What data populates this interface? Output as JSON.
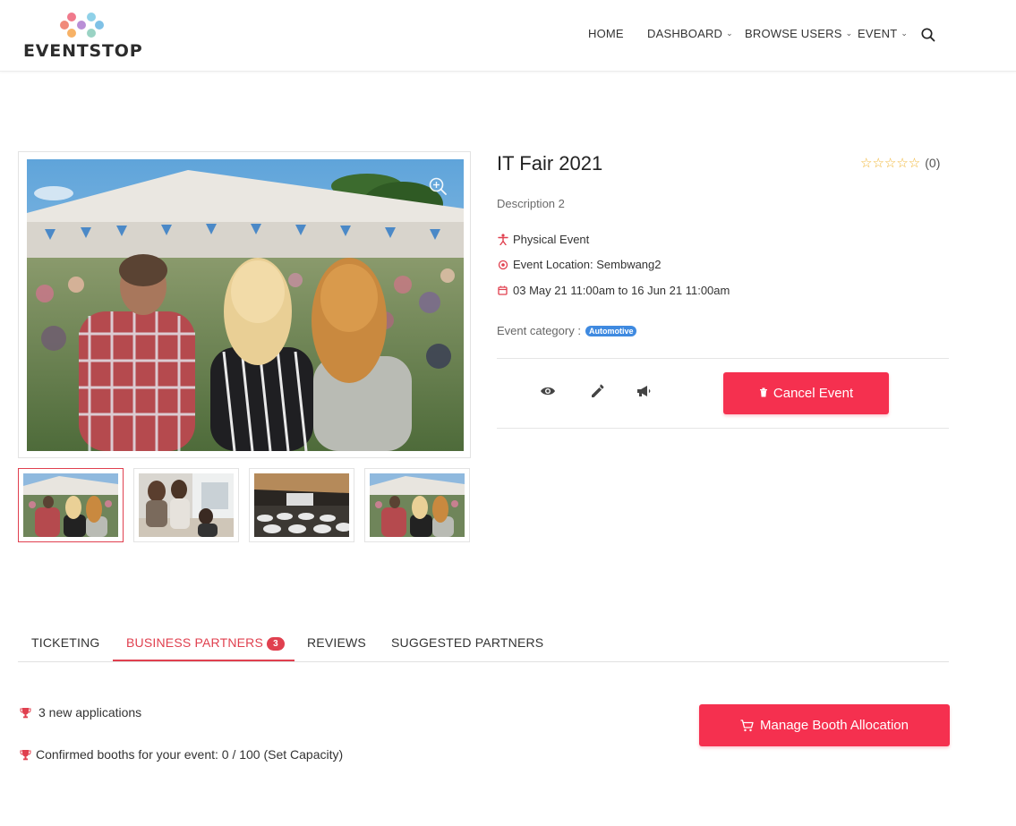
{
  "brand": {
    "name": "EVENTSTOP"
  },
  "nav": {
    "items": [
      {
        "label": "HOME",
        "has_dropdown": false
      },
      {
        "label": "DASHBOARD",
        "has_dropdown": true
      },
      {
        "label": "BROWSE USERS",
        "has_dropdown": true
      },
      {
        "label": "EVENT",
        "has_dropdown": true
      }
    ],
    "search_icon": "search-icon"
  },
  "event": {
    "title": "IT Fair 2021",
    "rating": {
      "stars": "☆☆☆☆☆",
      "count_label": "(0)"
    },
    "description": "Description 2",
    "type": "Physical Event",
    "location": "Event Location: Sembwang2",
    "dates": "03 May 21 11:00am to 16 Jun 21 11:00am",
    "category_label": "Event category :",
    "category_badge": "Automotive",
    "cancel_label": "Cancel Event"
  },
  "gallery": {
    "thumbnails": [
      "tent-crowd",
      "office-meeting",
      "conference-hall",
      "tent-crowd"
    ],
    "active_index": 0
  },
  "tabs": [
    {
      "label": "TICKETING",
      "active": false
    },
    {
      "label": "BUSINESS PARTNERS",
      "active": true,
      "badge": "3"
    },
    {
      "label": "REVIEWS",
      "active": false
    },
    {
      "label": "SUGGESTED PARTNERS",
      "active": false
    }
  ],
  "business_partners": {
    "applications_text": "3 new applications",
    "confirmed_text": "Confirmed booths for your event: 0 / 100 (Set Capacity)",
    "manage_button_label": "Manage Booth Allocation"
  },
  "colors": {
    "accent": "#f5304f",
    "badge_blue": "#3f8ae0",
    "star": "#f0b533"
  }
}
